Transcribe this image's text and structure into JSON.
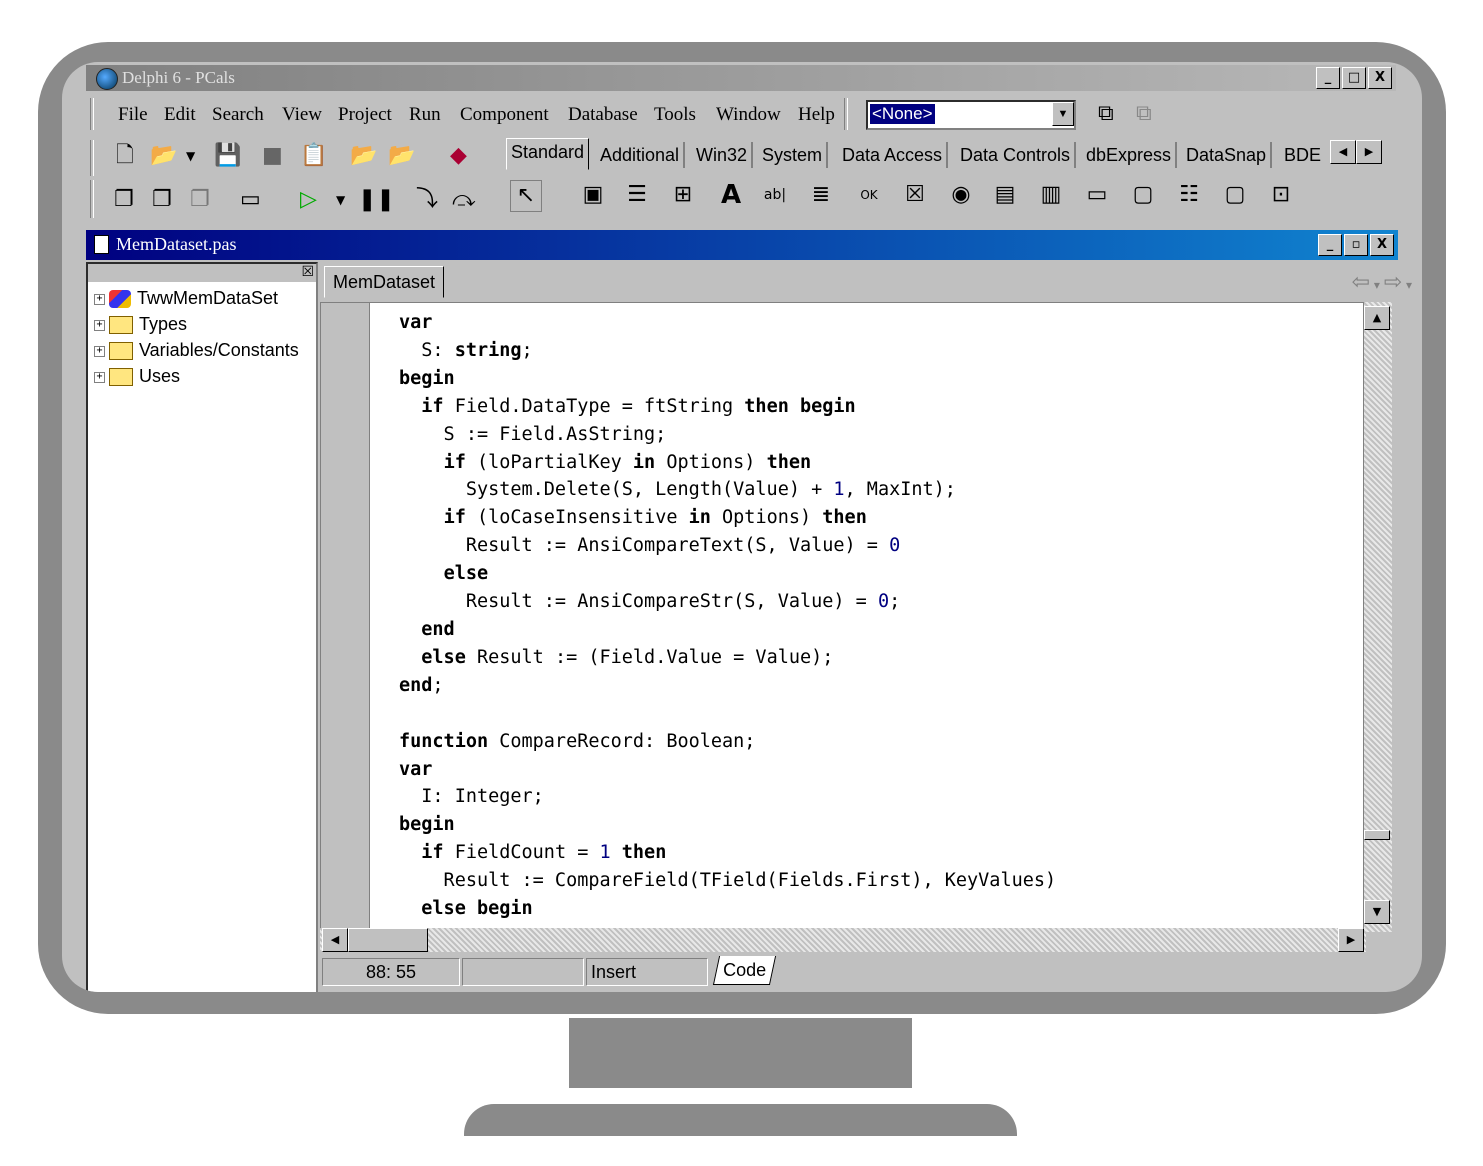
{
  "window": {
    "title": "Delphi 6 - PCals",
    "controls": [
      "_",
      "□",
      "X"
    ]
  },
  "menu": [
    "File",
    "Edit",
    "Search",
    "View",
    "Project",
    "Run",
    "Component",
    "Database",
    "Tools",
    "Window",
    "Help"
  ],
  "combo": {
    "value": "<None>"
  },
  "palette_tabs": [
    "Standard",
    "Additional",
    "Win32",
    "System",
    "Data Access",
    "Data Controls",
    "dbExpress",
    "DataSnap",
    "BDE"
  ],
  "palette_active": "Standard",
  "editor": {
    "title": "MemDataset.pas",
    "controls": [
      "_",
      "▫",
      "X"
    ],
    "tab": "MemDataset"
  },
  "explorer": {
    "items": [
      {
        "label": "TwwMemDataSet",
        "icon": "component-icon"
      },
      {
        "label": "Types",
        "icon": "folder-icon"
      },
      {
        "label": "Variables/Constants",
        "icon": "folder-icon"
      },
      {
        "label": "Uses",
        "icon": "folder-icon"
      }
    ]
  },
  "code": [
    "var",
    "  S: string;",
    "begin",
    "  if Field.DataType = ftString then begin",
    "    S := Field.AsString;",
    "    if (loPartialKey in Options) then",
    "      System.Delete(S, Length(Value) + 1, MaxInt);",
    "    if (loCaseInsensitive in Options) then",
    "      Result := AnsiCompareText(S, Value) = 0",
    "    else",
    "      Result := AnsiCompareStr(S, Value) = 0;",
    "  end",
    "  else Result := (Field.Value = Value);",
    "end;",
    "",
    "function CompareRecord: Boolean;",
    "var",
    "  I: Integer;",
    "begin",
    "  if FieldCount = 1 then",
    "    Result := CompareField(TField(Fields.First), KeyValues)",
    "  else begin"
  ],
  "status": {
    "position": "88: 55",
    "mode": "Insert",
    "view_tab": "Code"
  }
}
